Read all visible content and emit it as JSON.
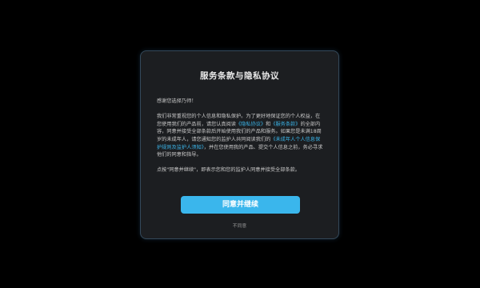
{
  "dialog": {
    "title": "服务条款与隐私协议",
    "greeting": "感谢您选择乃师！",
    "para1": {
      "part1": "我们非常重视您的个人信息和隐私保护。为了更好地保证您的个人权益，在您使用我们的产品前，请您认真阅读",
      "link_privacy": "《隐私协议》",
      "and": "和",
      "link_terms": "《服务条款》",
      "part2": "的全部内容，同意并接受全部条款后开始使用我们的产品和服务。如果您是未满18周岁的未成年人，请您通知您的监护人共同阅读我们的",
      "link_minor": "《未成年人个人信息保护规则及监护人须知》",
      "part3": "，并在您使用我的产品、提交个人信息之前，务必寻求他们的同意和指导。"
    },
    "para2": "点按\"同意并继续\"，即表示您和您的监护人同意并接受全部条款。",
    "agree_label": "同意并继续",
    "disagree_label": "不同意"
  },
  "colors": {
    "background": "#000000",
    "dialog_bg": "#1c1e21",
    "dialog_border": "#34495a",
    "accent": "#3ab6ec",
    "link": "#3bb4e8"
  }
}
